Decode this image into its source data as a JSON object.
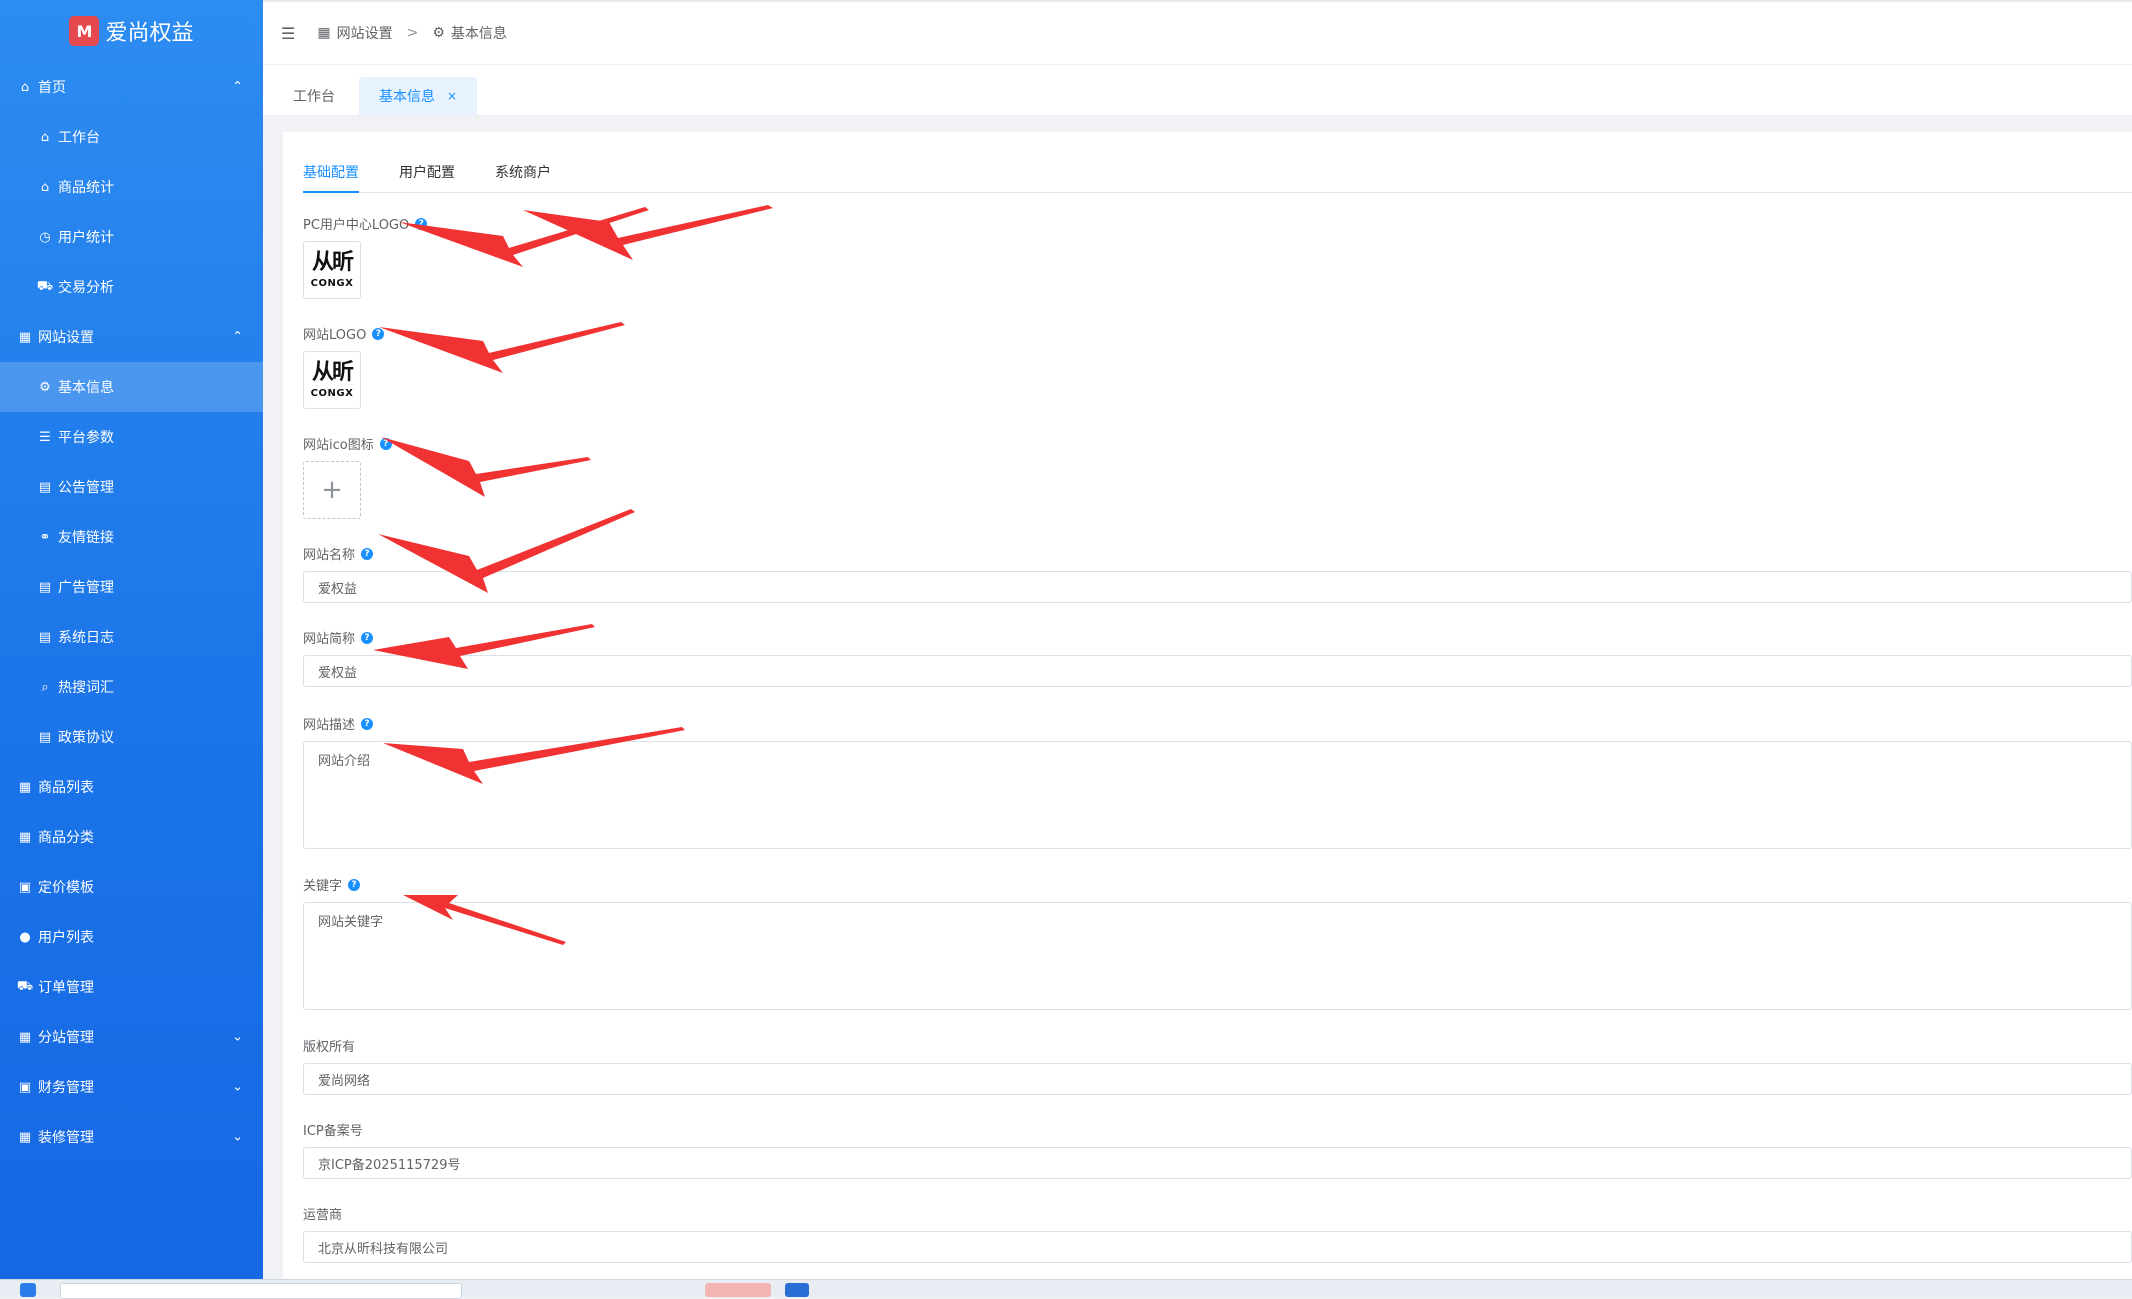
{
  "brand": {
    "name": "爱尚权益",
    "logo_glyph": "M"
  },
  "sidebar": {
    "items": [
      {
        "label": "首页",
        "icon": "home-icon",
        "glyph": "⌂",
        "level": 1,
        "chevron": "up"
      },
      {
        "label": "工作台",
        "icon": "home-icon",
        "glyph": "⌂",
        "level": 2
      },
      {
        "label": "商品统计",
        "icon": "shop-icon",
        "glyph": "⌂",
        "level": 2
      },
      {
        "label": "用户统计",
        "icon": "clock-icon",
        "glyph": "◷",
        "level": 2
      },
      {
        "label": "交易分析",
        "icon": "cart-icon",
        "glyph": "⛟",
        "level": 2
      },
      {
        "label": "网站设置",
        "icon": "building-icon",
        "glyph": "▦",
        "level": 1,
        "chevron": "up"
      },
      {
        "label": "基本信息",
        "icon": "gear-icon",
        "glyph": "⚙",
        "level": 2,
        "active": true
      },
      {
        "label": "平台参数",
        "icon": "sliders-icon",
        "glyph": "☰",
        "level": 2
      },
      {
        "label": "公告管理",
        "icon": "notice-icon",
        "glyph": "▤",
        "level": 2
      },
      {
        "label": "友情链接",
        "icon": "link-icon",
        "glyph": "⚭",
        "level": 2
      },
      {
        "label": "广告管理",
        "icon": "ad-icon",
        "glyph": "▤",
        "level": 2
      },
      {
        "label": "系统日志",
        "icon": "log-icon",
        "glyph": "▤",
        "level": 2
      },
      {
        "label": "热搜词汇",
        "icon": "search-icon",
        "glyph": "⌕",
        "level": 2
      },
      {
        "label": "政策协议",
        "icon": "document-icon",
        "glyph": "▤",
        "level": 2
      },
      {
        "label": "商品列表",
        "icon": "list-icon",
        "glyph": "▦",
        "level": 1
      },
      {
        "label": "商品分类",
        "icon": "grid-icon",
        "glyph": "▦",
        "level": 1
      },
      {
        "label": "定价模板",
        "icon": "price-icon",
        "glyph": "▣",
        "level": 1
      },
      {
        "label": "用户列表",
        "icon": "user-icon",
        "glyph": "●",
        "level": 1
      },
      {
        "label": "订单管理",
        "icon": "cart-icon",
        "glyph": "⛟",
        "level": 1
      },
      {
        "label": "分站管理",
        "icon": "store-icon",
        "glyph": "▦",
        "level": 1,
        "chevron": "down"
      },
      {
        "label": "财务管理",
        "icon": "finance-icon",
        "glyph": "▣",
        "level": 1,
        "chevron": "down"
      },
      {
        "label": "装修管理",
        "icon": "decor-icon",
        "glyph": "▦",
        "level": 1,
        "chevron": "down"
      }
    ]
  },
  "breadcrumb": {
    "parent": "网站设置",
    "separator": ">",
    "current": "基本信息"
  },
  "tabs": [
    {
      "label": "工作台",
      "active": false
    },
    {
      "label": "基本信息",
      "active": true,
      "close": "×"
    }
  ],
  "subtabs": [
    {
      "label": "基础配置",
      "active": true
    },
    {
      "label": "用户配置",
      "active": false
    },
    {
      "label": "系统商户",
      "active": false
    }
  ],
  "form": {
    "pc_logo": {
      "label": "PC用户中心LOGO",
      "logo_text": "从昕",
      "logo_sub": "CONGX"
    },
    "site_logo": {
      "label": "网站LOGO",
      "logo_text": "从昕",
      "logo_sub": "CONGX"
    },
    "site_ico": {
      "label": "网站ico图标",
      "plus": "+"
    },
    "site_name": {
      "label": "网站名称",
      "value": "爱权益"
    },
    "site_short": {
      "label": "网站简称",
      "value": "爱权益"
    },
    "site_desc": {
      "label": "网站描述",
      "placeholder": "网站介绍"
    },
    "keywords": {
      "label": "关键字",
      "placeholder": "网站关键字"
    },
    "copyright": {
      "label": "版权所有",
      "value": "爱尚网络"
    },
    "icp": {
      "label": "ICP备案号",
      "value": "京ICP备2025115729号"
    },
    "operator": {
      "label": "运营商",
      "value": "北京从昕科技有限公司"
    }
  },
  "colors": {
    "accent": "#1890ff",
    "sidebar": "#1a73e8",
    "arrow": "#f03232"
  }
}
